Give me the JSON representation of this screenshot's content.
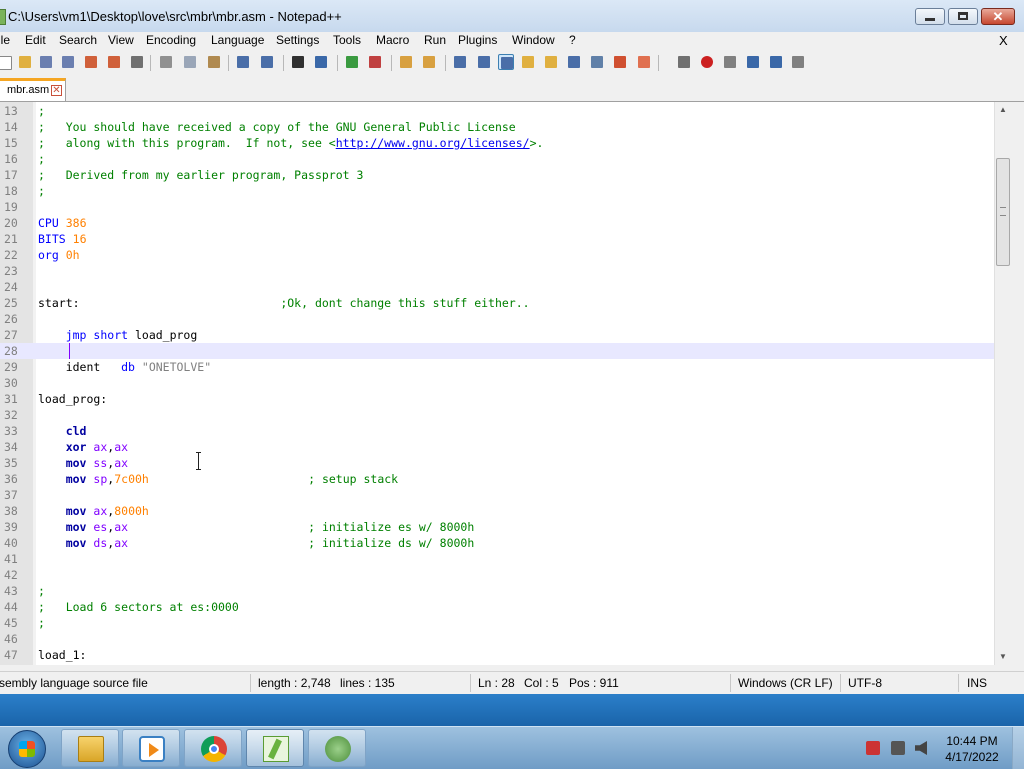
{
  "window": {
    "title": "C:\\Users\\vm1\\Desktop\\love\\src\\mbr\\mbr.asm - Notepad++",
    "close_doc": "X"
  },
  "menu": [
    "ile",
    "Edit",
    "Search",
    "View",
    "Encoding",
    "Language",
    "Settings",
    "Tools",
    "Macro",
    "Run",
    "Plugins",
    "Window",
    "?"
  ],
  "toolbar_icons": [
    {
      "name": "new-file-icon",
      "color": "#ffffff"
    },
    {
      "name": "open-file-icon",
      "color": "#e0b040"
    },
    {
      "name": "save-icon",
      "color": "#6b7fb0"
    },
    {
      "name": "save-all-icon",
      "color": "#6b7fb0"
    },
    {
      "name": "close-icon",
      "color": "#d0603a"
    },
    {
      "name": "close-all-icon",
      "color": "#d0603a"
    },
    {
      "name": "print-icon",
      "color": "#707070"
    },
    {
      "name": "cut-icon",
      "color": "#909090"
    },
    {
      "name": "copy-icon",
      "color": "#9aa6b8"
    },
    {
      "name": "paste-icon",
      "color": "#b08a50"
    },
    {
      "name": "undo-icon",
      "color": "#4a6ea8"
    },
    {
      "name": "redo-icon",
      "color": "#4a6ea8"
    },
    {
      "name": "find-icon",
      "color": "#303030"
    },
    {
      "name": "replace-icon",
      "color": "#3a68a8"
    },
    {
      "name": "zoom-in-icon",
      "color": "#3a9a40"
    },
    {
      "name": "zoom-out-icon",
      "color": "#c04040"
    },
    {
      "name": "sync-vertical-icon",
      "color": "#d8a040"
    },
    {
      "name": "sync-horizontal-icon",
      "color": "#d8a040"
    },
    {
      "name": "word-wrap-icon",
      "color": "#4a6ea8"
    },
    {
      "name": "show-all-chars-icon",
      "color": "#4a6ea8"
    },
    {
      "name": "indent-guide-icon",
      "color": "#4a6ea8"
    },
    {
      "name": "doc-map-icon",
      "color": "#e0b040"
    },
    {
      "name": "function-list-icon",
      "color": "#e0b040"
    },
    {
      "name": "folder-workspace-icon",
      "color": "#4a6ea8"
    },
    {
      "name": "doc-switcher-icon",
      "color": "#6080a8"
    },
    {
      "name": "define-lang-icon",
      "color": "#d05030"
    },
    {
      "name": "monitoring-icon",
      "color": "#e07050"
    },
    {
      "name": "eye-icon",
      "color": "#707070"
    },
    {
      "name": "record-macro-icon",
      "color": "#cc2020"
    },
    {
      "name": "stop-macro-icon",
      "color": "#808080"
    },
    {
      "name": "play-macro-icon",
      "color": "#3a68a8"
    },
    {
      "name": "run-macro-multiple-icon",
      "color": "#3a68a8"
    },
    {
      "name": "save-macro-icon",
      "color": "#808080"
    }
  ],
  "tab": {
    "label": "mbr.asm"
  },
  "editor": {
    "first_line": 13,
    "current_line": 28,
    "lines": [
      {
        "n": "13",
        "t": [
          {
            "c": "comment",
            "s": ";"
          }
        ]
      },
      {
        "n": "14",
        "t": [
          {
            "c": "comment",
            "s": ";   You should have received a copy of the GNU General Public License"
          }
        ]
      },
      {
        "n": "15",
        "t": [
          {
            "c": "comment",
            "s": ";   along with this program.  If not, see <"
          },
          {
            "c": "link",
            "s": "http://www.gnu.org/licenses/"
          },
          {
            "c": "comment",
            "s": ">."
          }
        ]
      },
      {
        "n": "16",
        "t": [
          {
            "c": "comment",
            "s": ";"
          }
        ]
      },
      {
        "n": "17",
        "t": [
          {
            "c": "comment",
            "s": ";   Derived from my earlier program, Passprot 3"
          }
        ]
      },
      {
        "n": "18",
        "t": [
          {
            "c": "comment",
            "s": ";"
          }
        ]
      },
      {
        "n": "19",
        "t": []
      },
      {
        "n": "20",
        "t": [
          {
            "c": "kw",
            "s": "CPU"
          },
          {
            "c": "ident",
            "s": " "
          },
          {
            "c": "num",
            "s": "386"
          }
        ]
      },
      {
        "n": "21",
        "t": [
          {
            "c": "kw",
            "s": "BITS"
          },
          {
            "c": "ident",
            "s": " "
          },
          {
            "c": "num",
            "s": "16"
          }
        ]
      },
      {
        "n": "22",
        "t": [
          {
            "c": "kw",
            "s": "org"
          },
          {
            "c": "ident",
            "s": " "
          },
          {
            "c": "num",
            "s": "0h"
          }
        ]
      },
      {
        "n": "23",
        "t": []
      },
      {
        "n": "24",
        "t": []
      },
      {
        "n": "25",
        "t": [
          {
            "c": "ident",
            "s": "start:                             "
          },
          {
            "c": "comment",
            "s": ";Ok, dont change this stuff either.."
          }
        ]
      },
      {
        "n": "26",
        "t": []
      },
      {
        "n": "27",
        "t": [
          {
            "c": "ident",
            "s": "    "
          },
          {
            "c": "kw",
            "s": "jmp"
          },
          {
            "c": "ident",
            "s": " "
          },
          {
            "c": "kw",
            "s": "short"
          },
          {
            "c": "ident",
            "s": " load_prog"
          }
        ]
      },
      {
        "n": "28",
        "t": []
      },
      {
        "n": "29",
        "t": [
          {
            "c": "ident",
            "s": "    ident   "
          },
          {
            "c": "kw",
            "s": "db"
          },
          {
            "c": "ident",
            "s": " "
          },
          {
            "c": "str",
            "s": "\"ONETOLVE\""
          }
        ]
      },
      {
        "n": "30",
        "t": []
      },
      {
        "n": "31",
        "t": [
          {
            "c": "ident",
            "s": "load_prog:"
          }
        ]
      },
      {
        "n": "32",
        "t": []
      },
      {
        "n": "33",
        "t": [
          {
            "c": "ident",
            "s": "    "
          },
          {
            "c": "instr",
            "s": "cld"
          }
        ]
      },
      {
        "n": "34",
        "t": [
          {
            "c": "ident",
            "s": "    "
          },
          {
            "c": "instr",
            "s": "xor"
          },
          {
            "c": "ident",
            "s": " "
          },
          {
            "c": "reg",
            "s": "ax"
          },
          {
            "c": "ident",
            "s": ","
          },
          {
            "c": "reg",
            "s": "ax"
          }
        ]
      },
      {
        "n": "35",
        "t": [
          {
            "c": "ident",
            "s": "    "
          },
          {
            "c": "instr",
            "s": "mov"
          },
          {
            "c": "ident",
            "s": " "
          },
          {
            "c": "reg",
            "s": "ss"
          },
          {
            "c": "ident",
            "s": ","
          },
          {
            "c": "reg",
            "s": "ax"
          }
        ]
      },
      {
        "n": "36",
        "t": [
          {
            "c": "ident",
            "s": "    "
          },
          {
            "c": "instr",
            "s": "mov"
          },
          {
            "c": "ident",
            "s": " "
          },
          {
            "c": "reg",
            "s": "sp"
          },
          {
            "c": "ident",
            "s": ","
          },
          {
            "c": "num",
            "s": "7c00h"
          },
          {
            "c": "ident",
            "s": "                       "
          },
          {
            "c": "comment",
            "s": "; setup stack"
          }
        ]
      },
      {
        "n": "37",
        "t": []
      },
      {
        "n": "38",
        "t": [
          {
            "c": "ident",
            "s": "    "
          },
          {
            "c": "instr",
            "s": "mov"
          },
          {
            "c": "ident",
            "s": " "
          },
          {
            "c": "reg",
            "s": "ax"
          },
          {
            "c": "ident",
            "s": ","
          },
          {
            "c": "num",
            "s": "8000h"
          }
        ]
      },
      {
        "n": "39",
        "t": [
          {
            "c": "ident",
            "s": "    "
          },
          {
            "c": "instr",
            "s": "mov"
          },
          {
            "c": "ident",
            "s": " "
          },
          {
            "c": "reg",
            "s": "es"
          },
          {
            "c": "ident",
            "s": ","
          },
          {
            "c": "reg",
            "s": "ax"
          },
          {
            "c": "ident",
            "s": "                          "
          },
          {
            "c": "comment",
            "s": "; initialize es w/ 8000h"
          }
        ]
      },
      {
        "n": "40",
        "t": [
          {
            "c": "ident",
            "s": "    "
          },
          {
            "c": "instr",
            "s": "mov"
          },
          {
            "c": "ident",
            "s": " "
          },
          {
            "c": "reg",
            "s": "ds"
          },
          {
            "c": "ident",
            "s": ","
          },
          {
            "c": "reg",
            "s": "ax"
          },
          {
            "c": "ident",
            "s": "                          "
          },
          {
            "c": "comment",
            "s": "; initialize ds w/ 8000h"
          }
        ]
      },
      {
        "n": "41",
        "t": []
      },
      {
        "n": "42",
        "t": []
      },
      {
        "n": "43",
        "t": [
          {
            "c": "comment",
            "s": ";"
          }
        ]
      },
      {
        "n": "44",
        "t": [
          {
            "c": "comment",
            "s": ";   Load 6 sectors at es:0000"
          }
        ]
      },
      {
        "n": "45",
        "t": [
          {
            "c": "comment",
            "s": ";"
          }
        ]
      },
      {
        "n": "46",
        "t": []
      },
      {
        "n": "47",
        "t": [
          {
            "c": "ident",
            "s": "load_1:"
          }
        ]
      }
    ]
  },
  "scroll": {
    "up_arrow": "▲",
    "down_arrow": "▼"
  },
  "status": {
    "file_type": "sembly language source file",
    "length": "length : 2,748",
    "lines": "lines : 135",
    "ln": "Ln : 28",
    "col": "Col : 5",
    "pos": "Pos : 911",
    "eol": "Windows (CR LF)",
    "encoding": "UTF-8",
    "mode": "INS"
  },
  "taskbar": {
    "apps": [
      {
        "name": "explorer",
        "icon": "folder-icon"
      },
      {
        "name": "media-player",
        "icon": "media-player-icon"
      },
      {
        "name": "chrome",
        "icon": "chrome-icon"
      },
      {
        "name": "notepad-plus-plus",
        "icon": "notepad-plus-plus-icon",
        "active": true
      },
      {
        "name": "other-app",
        "icon": "app-icon"
      }
    ],
    "time": "10:44 PM",
    "date": "4/17/2022"
  }
}
